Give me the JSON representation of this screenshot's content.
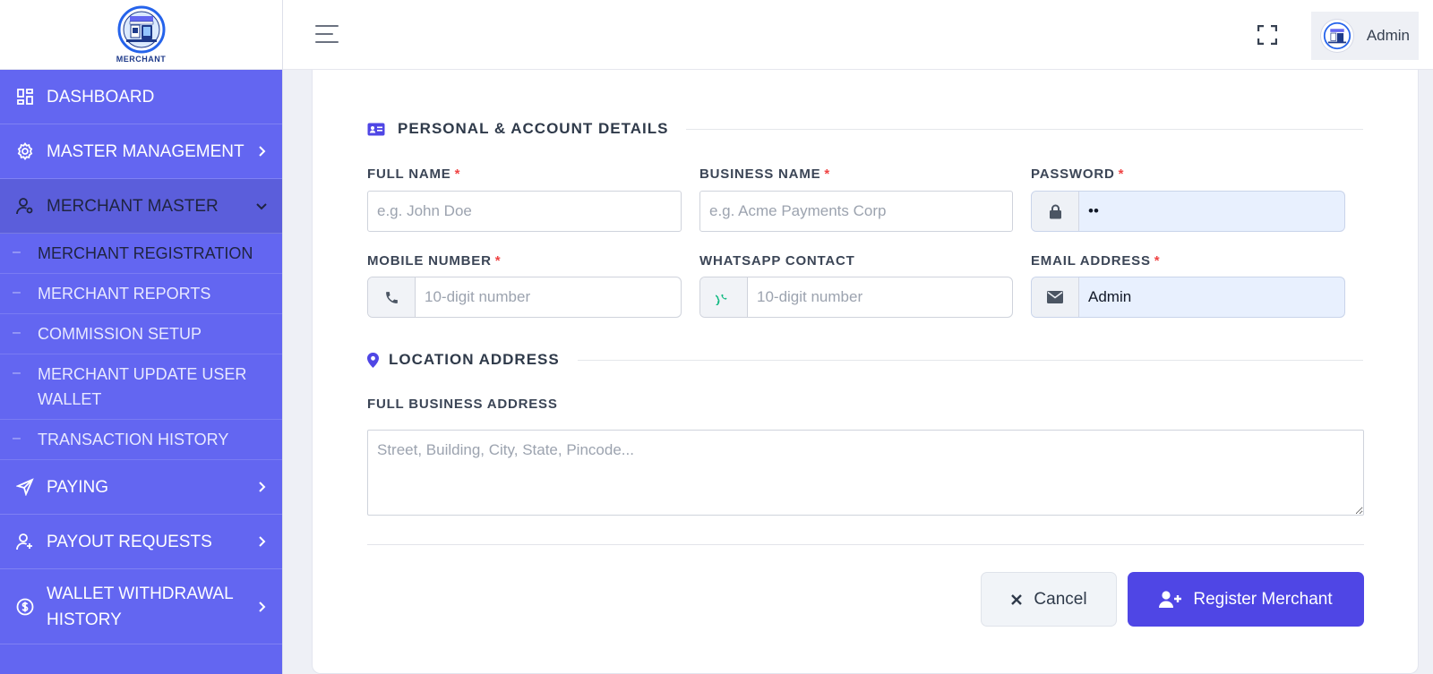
{
  "brand": {
    "logo_text": "MERCHANT"
  },
  "sidebar": {
    "items": [
      {
        "label": "DASHBOARD",
        "icon": "dashboard-icon"
      },
      {
        "label": "MASTER MANAGEMENT",
        "icon": "gear-icon"
      },
      {
        "label": "MERCHANT MASTER",
        "icon": "user-gear-icon"
      },
      {
        "label": "PAYING",
        "icon": "send-icon"
      },
      {
        "label": "PAYOUT REQUESTS",
        "icon": "user-plus-icon"
      },
      {
        "label": "WALLET WITHDRAWAL HISTORY",
        "icon": "dollar-circle-icon"
      }
    ],
    "submenu": [
      {
        "label": "MERCHANT REGISTRATION",
        "active": true
      },
      {
        "label": "MERCHANT REPORTS"
      },
      {
        "label": "COMMISSION SETUP"
      },
      {
        "label": "MERCHANT UPDATE USER WALLET"
      },
      {
        "label": "TRANSACTION HISTORY"
      }
    ]
  },
  "topbar": {
    "user_name": "Admin"
  },
  "form": {
    "section1_title": "PERSONAL & ACCOUNT DETAILS",
    "section2_title": "LOCATION ADDRESS",
    "required_mark": "*",
    "full_name": {
      "label": "FULL NAME",
      "placeholder": "e.g. John Doe",
      "value": ""
    },
    "business_name": {
      "label": "BUSINESS NAME",
      "placeholder": "e.g. Acme Payments Corp",
      "value": ""
    },
    "password": {
      "label": "PASSWORD",
      "value": "••"
    },
    "mobile": {
      "label": "MOBILE NUMBER",
      "placeholder": "10-digit number",
      "value": ""
    },
    "whatsapp": {
      "label": "WHATSAPP CONTACT",
      "placeholder": "10-digit number",
      "value": ""
    },
    "email": {
      "label": "EMAIL ADDRESS",
      "value": "Admin"
    },
    "address": {
      "label": "FULL BUSINESS ADDRESS",
      "placeholder": "Street, Building, City, State, Pincode..."
    },
    "cancel_label": "Cancel",
    "register_label": "Register Merchant"
  },
  "colors": {
    "sidebar": "#6366f1",
    "primary_button": "#4f46e5",
    "required": "#ef4444",
    "whatsapp": "#10b981",
    "section_icon": "#4f46e5"
  }
}
